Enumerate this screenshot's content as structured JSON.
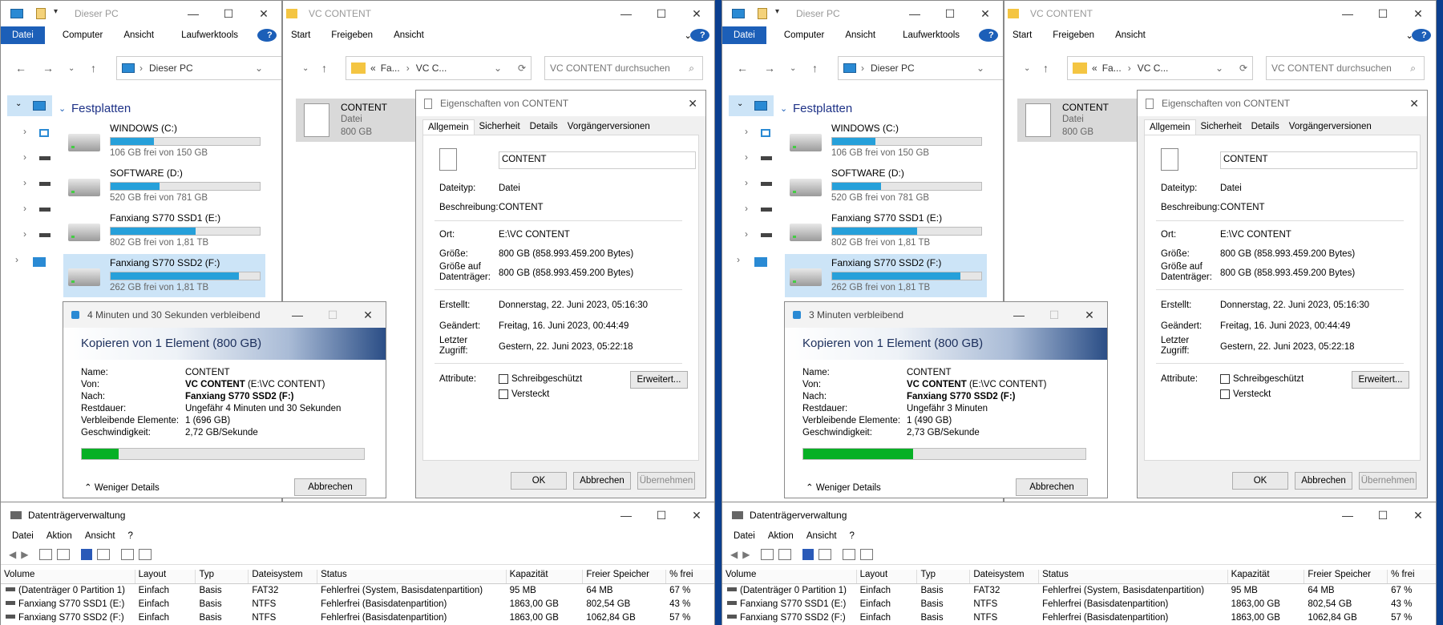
{
  "explorer": {
    "title": "Dieser PC",
    "menu": [
      "Datei",
      "Computer",
      "Ansicht",
      "Laufwerktools"
    ],
    "help": "?",
    "address": "Dieser PC",
    "section": "Festplatten",
    "drives": [
      {
        "name": "WINDOWS (C:)",
        "free": "106 GB frei von 150 GB",
        "used_fraction": 0.29
      },
      {
        "name": "SOFTWARE (D:)",
        "free": "520 GB frei von 781 GB",
        "used_fraction": 0.33
      },
      {
        "name": "Fanxiang S770 SSD1 (E:)",
        "free": "802 GB frei von 1,81 TB",
        "used_fraction": 0.57
      },
      {
        "name": "Fanxiang S770 SSD2 (F:)",
        "free": "262 GB frei von 1,81 TB",
        "used_fraction": 0.86
      }
    ]
  },
  "vc": {
    "title": "VC CONTENT",
    "menu": [
      "Start",
      "Freigeben",
      "Ansicht"
    ],
    "address_a": "Fa...",
    "address_b": "VC C...",
    "search_placeholder": "VC CONTENT durchsuchen",
    "file_name": "CONTENT",
    "file_type": "Datei",
    "file_size": "800 GB"
  },
  "props": {
    "title": "Eigenschaften von CONTENT",
    "tabs": [
      "Allgemein",
      "Sicherheit",
      "Details",
      "Vorgängerversionen"
    ],
    "name": "CONTENT",
    "rows1": [
      [
        "Dateityp:",
        "Datei"
      ],
      [
        "Beschreibung:",
        "CONTENT"
      ]
    ],
    "rows2": [
      [
        "Ort:",
        "E:\\VC CONTENT"
      ],
      [
        "Größe:",
        "800 GB (858.993.459.200 Bytes)"
      ],
      [
        "Größe auf Datenträger:",
        "800 GB (858.993.459.200 Bytes)"
      ]
    ],
    "rows3": [
      [
        "Erstellt:",
        "Donnerstag, 22. Juni 2023, 05:16:30"
      ],
      [
        "Geändert:",
        "Freitag, 16. Juni 2023, 00:44:49"
      ],
      [
        "Letzter Zugriff:",
        "Gestern, 22. Juni 2023, 05:22:18"
      ]
    ],
    "attr_label": "Attribute:",
    "readonly": "Schreibgeschützt",
    "hidden": "Versteckt",
    "advanced": "Erweitert...",
    "ok": "OK",
    "cancel": "Abbrechen",
    "apply": "Übernehmen"
  },
  "copy": [
    {
      "title": "4 Minuten und 30 Sekunden verbleibend",
      "heading": "Kopieren von 1 Element (800 GB)",
      "remaining": "Ungefähr 4 Minuten und 30 Sekunden",
      "items": "1 (696 GB)",
      "speed": "2,72 GB/Sekunde",
      "progress": 0.13
    },
    {
      "title": "3 Minuten verbleibend",
      "heading": "Kopieren von 1 Element (800 GB)",
      "remaining": "Ungefähr 3 Minuten",
      "items": "1 (490 GB)",
      "speed": "2,73 GB/Sekunde",
      "progress": 0.39
    }
  ],
  "copy_labels": {
    "name": "Name:",
    "from": "Von:",
    "to": "Nach:",
    "remaining": "Restdauer:",
    "items": "Verbleibende Elemente:",
    "speed": "Geschwindigkeit:",
    "name_val": "CONTENT",
    "from_bold": "VC CONTENT",
    "from_rest": "(E:\\VC CONTENT)",
    "to_val": "Fanxiang S770 SSD2 (F:)",
    "less": "Weniger Details",
    "cancel": "Abbrechen"
  },
  "dm": {
    "title": "Datenträgerverwaltung",
    "menu": [
      "Datei",
      "Aktion",
      "Ansicht",
      "?"
    ],
    "columns": [
      "Volume",
      "Layout",
      "Typ",
      "Dateisystem",
      "Status",
      "Kapazität",
      "Freier Speicher",
      "% frei"
    ],
    "rows": [
      [
        "(Datenträger 0 Partition 1)",
        "Einfach",
        "Basis",
        "FAT32",
        "Fehlerfrei (System, Basisdatenpartition)",
        "95 MB",
        "64 MB",
        "67 %"
      ],
      [
        "Fanxiang S770 SSD1 (E:)",
        "Einfach",
        "Basis",
        "NTFS",
        "Fehlerfrei (Basisdatenpartition)",
        "1863,00 GB",
        "802,54 GB",
        "43 %"
      ],
      [
        "Fanxiang S770 SSD2 (F:)",
        "Einfach",
        "Basis",
        "NTFS",
        "Fehlerfrei (Basisdatenpartition)",
        "1863,00 GB",
        "1062,84 GB",
        "57 %"
      ]
    ]
  },
  "colors": {
    "accent": "#1c5fb8",
    "progress": "#06b025",
    "desktop": "#0b3f8f",
    "drive_bar": "#26a0da"
  }
}
